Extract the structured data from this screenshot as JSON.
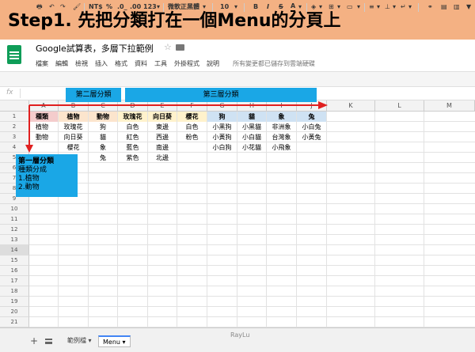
{
  "banner": {
    "title": "Step1. 先把分類打在一個Menu的分頁上"
  },
  "app": {
    "doc_title": "Google試算表，多層下拉範例",
    "menu": [
      "檔案",
      "編輯",
      "檢視",
      "插入",
      "格式",
      "資料",
      "工具",
      "外掛程式",
      "說明"
    ],
    "save_status": "所有變更都已儲存到雲端硬碟"
  },
  "toolbar": {
    "currency": "NT$",
    "percent": "%",
    "decimal_decrease": ".0_",
    "decimal_increase": ".00",
    "number_format": "123",
    "font": "微軟正黑體",
    "font_size": "10",
    "bold": "B",
    "italic": "I",
    "strike": "S",
    "text_color": "A"
  },
  "grid": {
    "columns": [
      "A",
      "B",
      "C",
      "D",
      "E",
      "F",
      "G",
      "H",
      "I",
      "J",
      "K",
      "L",
      "M"
    ],
    "rows": [
      "1",
      "2",
      "3",
      "4",
      "5",
      "6",
      "7",
      "8",
      "9",
      "10",
      "11",
      "12",
      "13",
      "14",
      "15",
      "16",
      "17",
      "18",
      "19",
      "20",
      "21"
    ],
    "cells": [
      [
        "種類",
        "植物",
        "動物",
        "玫瑰花",
        "向日葵",
        "櫻花",
        "狗",
        "貓",
        "象",
        "兔"
      ],
      [
        "植物",
        "玫瑰花",
        "狗",
        "白色",
        "東邊",
        "白色",
        "小黑狗",
        "小黑貓",
        "非洲象",
        "小白兔"
      ],
      [
        "動物",
        "向日葵",
        "貓",
        "紅色",
        "西邊",
        "粉色",
        "小黃狗",
        "小白貓",
        "台灣象",
        "小黃兔"
      ],
      [
        "",
        "櫻花",
        "象",
        "藍色",
        "南邊",
        "",
        "小白狗",
        "小花貓",
        "小飛象",
        ""
      ],
      [
        "",
        "",
        "兔",
        "紫色",
        "北邊",
        "",
        "",
        "",
        "",
        ""
      ]
    ],
    "header_colors": {
      "A": "#f4cccc",
      "B": "#fce5cd",
      "C": "#fce5cd",
      "D": "#fff2cc",
      "E": "#fff2cc",
      "F": "#fff2cc",
      "G": "#cfe2f3",
      "H": "#cfe2f3",
      "I": "#cfe2f3",
      "J": "#cfe2f3"
    }
  },
  "annotations": {
    "level2": "第二層分類",
    "level3": "第三層分類",
    "level1_title": "第一層分類",
    "level1_lines": [
      "種類分成",
      "1.植物",
      "2.動物"
    ],
    "callout_color": "#1aa7e6",
    "arrow_color": "#e02020"
  },
  "sheets": {
    "tabs": [
      "範例檔",
      "Menu"
    ],
    "active": "Menu",
    "add_label": "+"
  },
  "watermark": "RayLu"
}
